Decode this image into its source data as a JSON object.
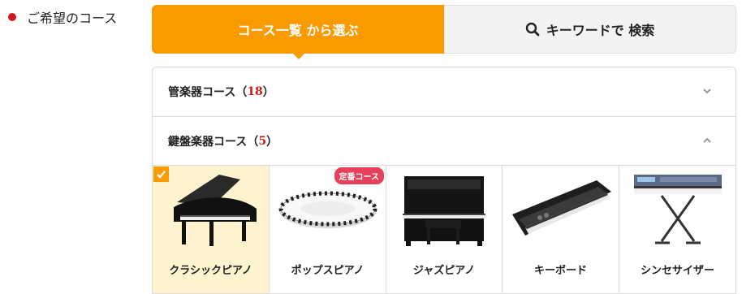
{
  "side": {
    "label": "ご希望のコース"
  },
  "tabs": [
    {
      "label": "コース一覧 から選ぶ"
    },
    {
      "label": "キーワードで 検索",
      "icon": "search-icon"
    }
  ],
  "accordion": [
    {
      "title": "管楽器コース（",
      "count": "18",
      "close": "）",
      "state": "collapsed"
    },
    {
      "title": "鍵盤楽器コース（",
      "count": "5",
      "close": "）",
      "state": "expanded"
    }
  ],
  "courses": [
    {
      "name": "クラシックピアノ",
      "selected": true
    },
    {
      "name": "ポップスピアノ",
      "badge": "定番コース"
    },
    {
      "name": "ジャズピアノ"
    },
    {
      "name": "キーボード"
    },
    {
      "name": "シンセサイザー"
    }
  ],
  "colors": {
    "accent": "#f89a00",
    "count": "#d01a1a",
    "badge": "#e8405a",
    "selected_bg": "#fff4cf"
  }
}
